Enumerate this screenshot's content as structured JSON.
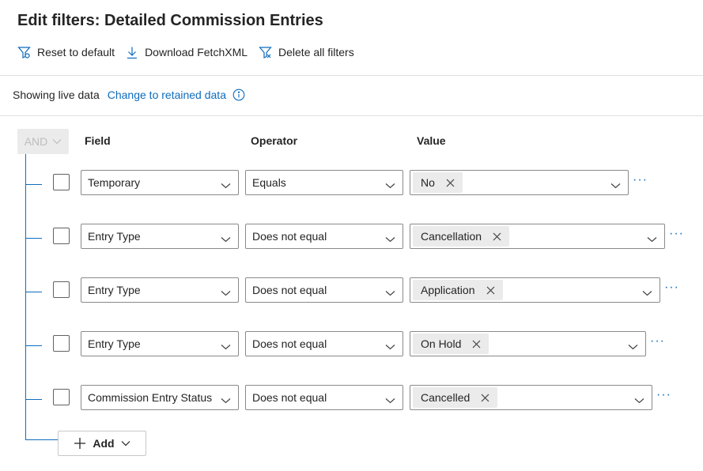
{
  "title": "Edit filters: Detailed Commission Entries",
  "toolbar": {
    "reset_label": "Reset to default",
    "download_label": "Download FetchXML",
    "delete_label": "Delete all filters"
  },
  "live": {
    "text": "Showing live data",
    "link": "Change to retained data"
  },
  "group": {
    "operator": "AND"
  },
  "columns": {
    "field": "Field",
    "operator": "Operator",
    "value": "Value"
  },
  "rows": [
    {
      "field": "Temporary",
      "operator": "Equals",
      "value": "No"
    },
    {
      "field": "Entry Type",
      "operator": "Does not equal",
      "value": "Cancellation"
    },
    {
      "field": "Entry Type",
      "operator": "Does not equal",
      "value": "Application"
    },
    {
      "field": "Entry Type",
      "operator": "Does not equal",
      "value": "On Hold"
    },
    {
      "field": "Commission Entry Status",
      "operator": "Does not equal",
      "value": "Cancelled"
    }
  ],
  "more_glyph": "···",
  "add_label": "Add",
  "colors": {
    "accent": "#0f6cbd",
    "text": "#242424",
    "disabled_bg": "#ebebeb"
  },
  "icons": [
    "filter-reset-icon",
    "download-icon",
    "filter-delete-icon",
    "info-icon",
    "chevron-down-icon",
    "dismiss-icon",
    "more-icon",
    "plus-icon"
  ]
}
